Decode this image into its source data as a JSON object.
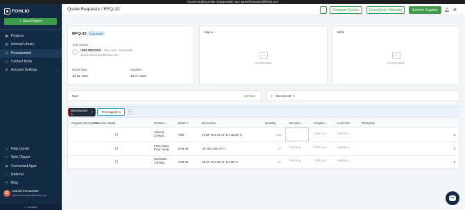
{
  "banner": {
    "text": "You are working under masquerade/ user daniel.fernandez@fohlio.com"
  },
  "sidebar": {
    "logo": "FOHLIO",
    "new_project": "New Project",
    "items": [
      {
        "label": "Projects",
        "icon": "briefcase-icon"
      },
      {
        "label": "Internal Library",
        "icon": "library-icon"
      },
      {
        "label": "Procurement",
        "icon": "cart-icon"
      },
      {
        "label": "Contact Book",
        "icon": "contact-book-icon"
      },
      {
        "label": "Account Settings",
        "icon": "settings-icon"
      }
    ],
    "bottom_items": [
      {
        "label": "Help Center",
        "icon": "help-icon"
      },
      {
        "label": "Web Clipper",
        "icon": "clipper-icon"
      },
      {
        "label": "Connected Apps",
        "icon": "apps-icon"
      },
      {
        "label": "Referral",
        "icon": "referral-icon"
      },
      {
        "label": "Blog",
        "icon": "blog-icon"
      }
    ],
    "user": {
      "initial": "D",
      "name": "Daniel Fernandez",
      "email": "daniel.fernandez@fohlio.com"
    },
    "collapse": "Collapse"
  },
  "topbar": {
    "breadcrumb": "Quote Requests / RFQ-32",
    "buttons": {
      "compare": "Compare Quotes",
      "enter_manually": "Enter Quote Manually",
      "send": "Send to Supplier"
    }
  },
  "rfq": {
    "number": "RFQ-32",
    "status": "Requested",
    "your_contact_label": "Your contact",
    "company": "UNO DESIGNS",
    "location": "New York",
    "contact_person": "Gainesville",
    "contact_email": "daniel.fernandez@fohlio.com",
    "quote_date_label": "Quote Date",
    "quote_date": "Jul 19, 2026",
    "deadline_label": "Deadline",
    "deadline": "Jul 27, 2026"
  },
  "ship_to": {
    "title": "Ship to",
    "empty": "No information"
  },
  "bill_to": {
    "title": "Bill to",
    "empty": "No information"
  },
  "note": {
    "label": "Note",
    "add": "Add Note"
  },
  "documents": {
    "label": "Documents",
    "count": "0"
  },
  "tabs": {
    "manufacturer": "Manufacturer A",
    "supplier": "Test Supplier 2",
    "add": "+"
  },
  "table": {
    "headers": [
      "Request Alternatives",
      "Selection Status",
      "Product ...",
      "Model #",
      "Dimension",
      "Quantity",
      "Unit price",
      "Freight c...",
      "Lead time",
      "Total price"
    ],
    "rows": [
      {
        "product": "Almeria Lounge...",
        "model": "7384",
        "dimension": "27.25\" W x 32.75\" D x 32.25\" H",
        "quantity": "200",
        "unit": "",
        "freight": "Click to e...",
        "lead": "Click to e...",
        "total": "0"
      },
      {
        "product": "Point Dume Floor Lamp",
        "model": "2045-36",
        "dimension": "16\" Dia x 65.75\" H",
        "quantity": "23",
        "unit": "Click to e...",
        "freight": "Click to e...",
        "lead": "Click to e...",
        "total": "0"
      },
      {
        "product": "Woodside Canopy...",
        "model": "7333-03",
        "dimension": "81.75\" W x 85.75\" D x 88\" H",
        "quantity": "56",
        "unit": "Click to e...",
        "freight": "Click to e...",
        "lead": "Click to e...",
        "total": "0"
      }
    ]
  },
  "colors": {
    "sidebar": "#132a44",
    "accent": "#3e9b47",
    "tab_highlight_red": "#d9312c",
    "tab_highlight_blue": "#2aa5c9"
  }
}
